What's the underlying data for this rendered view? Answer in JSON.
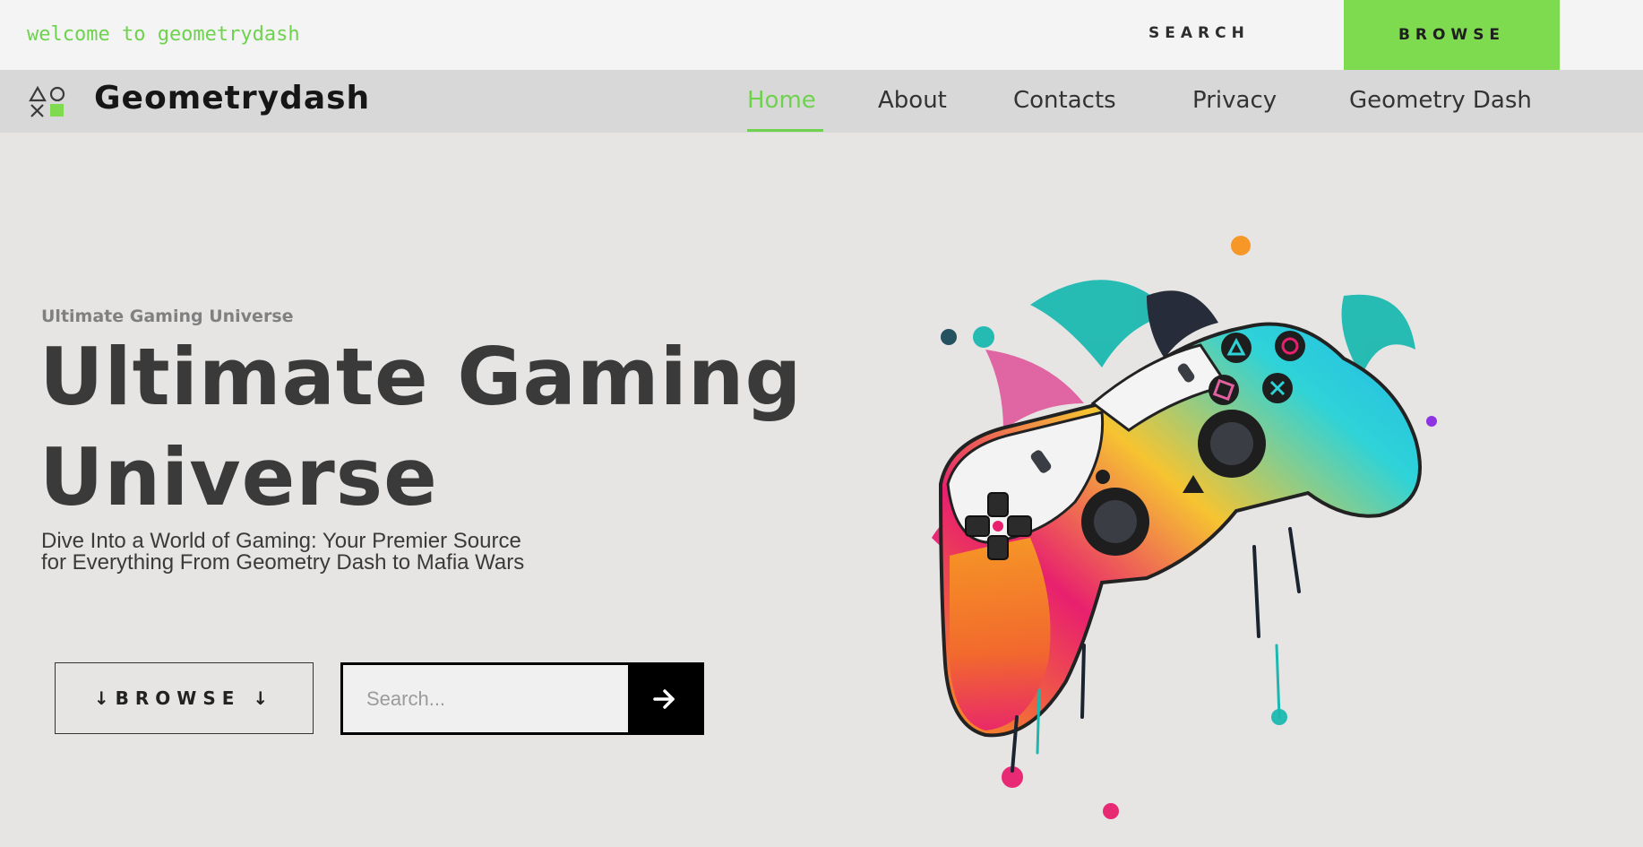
{
  "topbar": {
    "welcome": "welcome to geometrydash",
    "search_label": "SEARCH",
    "browse_label": "BROWSE"
  },
  "navbar": {
    "brand": "Geometrydash",
    "items": [
      {
        "label": "Home",
        "active": true
      },
      {
        "label": "About",
        "active": false
      },
      {
        "label": "Contacts",
        "active": false
      },
      {
        "label": "Privacy",
        "active": false
      },
      {
        "label": "Geometry Dash",
        "active": false
      }
    ]
  },
  "hero": {
    "eyebrow": "Ultimate Gaming Universe",
    "title": "Ultimate Gaming Universe",
    "description": "Dive Into a World of Gaming: Your Premier Source for Everything From Geometry Dash to Mafia Wars",
    "browse_button": "↓BROWSE ↓",
    "search_placeholder": "Search...",
    "search_value": ""
  },
  "icons": {
    "logo": "shapes-logo-icon",
    "submit": "arrow-right-icon",
    "illustration": "gamepad-controller-illustration"
  },
  "colors": {
    "accent": "#7edb4f",
    "accent_text": "#6fd24f",
    "background": "#e6e5e4",
    "topbar": "#f4f4f4",
    "navbar": "#d8d8d8",
    "dark": "#000000"
  }
}
